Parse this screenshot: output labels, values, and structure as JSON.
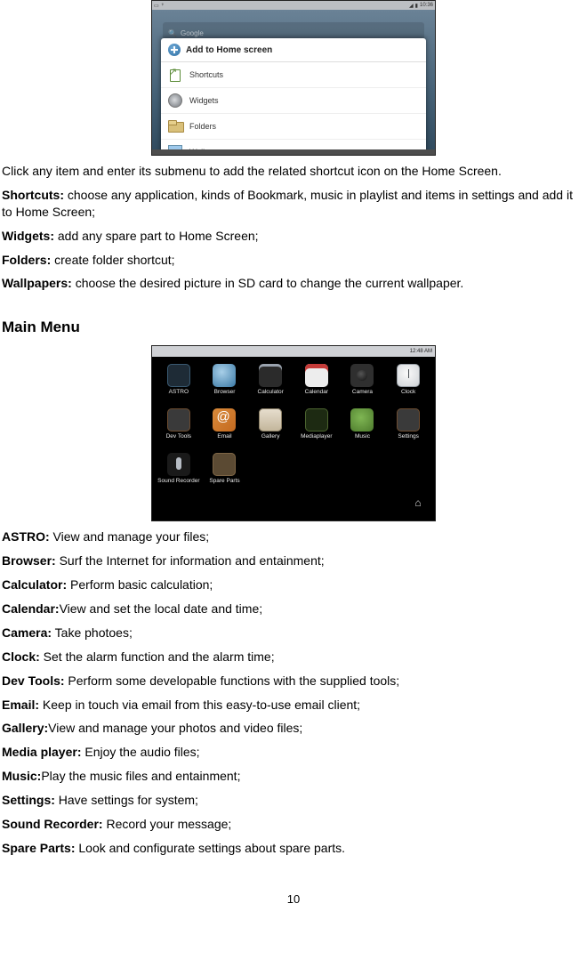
{
  "shot1": {
    "status_time": "10:36",
    "search_ghost": "Google",
    "sheet_title": "Add to Home screen",
    "items": [
      {
        "label": "Shortcuts"
      },
      {
        "label": "Widgets"
      },
      {
        "label": "Folders"
      },
      {
        "label": "Wallpapers"
      }
    ]
  },
  "para_click": "Click any item and enter its submenu to add the related shortcut icon on the Home Screen.",
  "shortcuts_label": "Shortcuts:",
  "shortcuts_text": " choose any application, kinds of Bookmark, music in playlist and items in settings and add it to Home Screen;",
  "widgets_label": "Widgets:",
  "widgets_text": " add any spare part to Home Screen;",
  "folders_label": "Folders:",
  "folders_text": " create folder shortcut;",
  "wallpapers_label": "Wallpapers:",
  "wallpapers_text": " choose the desired picture in SD card to change the current wallpaper.",
  "mainmenu_heading": "Main Menu",
  "shot2": {
    "status_time": "12:48 AM",
    "apps": [
      {
        "label": "ASTRO"
      },
      {
        "label": "Browser"
      },
      {
        "label": "Calculator"
      },
      {
        "label": "Calendar"
      },
      {
        "label": "Camera"
      },
      {
        "label": "Clock"
      },
      {
        "label": "Dev Tools"
      },
      {
        "label": "Email"
      },
      {
        "label": "Gallery"
      },
      {
        "label": "Mediaplayer"
      },
      {
        "label": "Music"
      },
      {
        "label": "Settings"
      },
      {
        "label": "Sound Recorder"
      },
      {
        "label": "Spare Parts"
      }
    ]
  },
  "defs": [
    {
      "term": "ASTRO:",
      "text": " View and manage your files;"
    },
    {
      "term": "Browser:",
      "text": " Surf the Internet for information and entainment;"
    },
    {
      "term": "Calculator:",
      "text": " Perform basic calculation;"
    },
    {
      "term": "Calendar:",
      "text": "View and set the local date and time;"
    },
    {
      "term": "Camera:",
      "text": " Take photoes;"
    },
    {
      "term": "Clock:",
      "text": " Set the alarm function and the alarm time;"
    },
    {
      "term": "Dev Tools:",
      "text": " Perform some developable functions with the supplied tools;"
    },
    {
      "term": "Email:",
      "text": " Keep in touch via email from this easy-to-use email client;"
    },
    {
      "term": "Gallery:",
      "text": "View and manage your photos and video files;"
    },
    {
      "term": "Media player:",
      "text": " Enjoy the audio files;"
    },
    {
      "term": "Music:",
      "text": "Play the music files and entainment;"
    },
    {
      "term": "Settings:",
      "text": " Have settings for system;"
    },
    {
      "term": "Sound Recorder:",
      "text": " Record your message;"
    },
    {
      "term": "Spare Parts:",
      "text": " Look and configurate settings about spare parts."
    }
  ],
  "page_number": "10"
}
